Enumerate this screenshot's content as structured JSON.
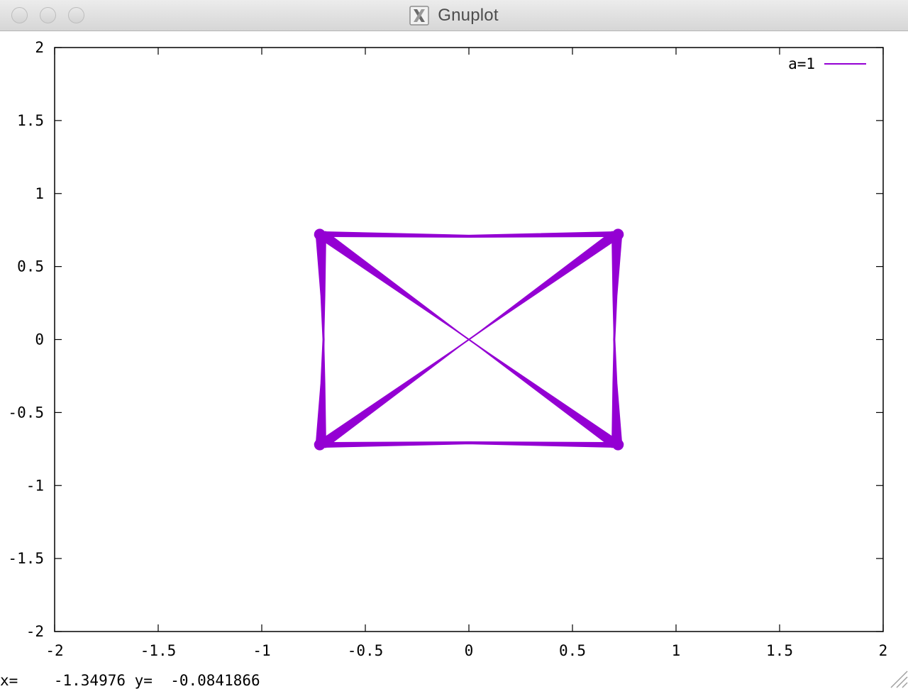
{
  "window": {
    "title": "Gnuplot"
  },
  "icons": {
    "app_icon": "x11-icon",
    "resize": "resize-grip-icon"
  },
  "chart_data": {
    "type": "line",
    "xlim": [
      -2,
      2
    ],
    "ylim": [
      -2,
      2
    ],
    "x_ticks": [
      "-2",
      "-1.5",
      "-1",
      "-0.5",
      "0",
      "0.5",
      "1",
      "1.5",
      "2"
    ],
    "y_ticks": [
      "-2",
      "-1.5",
      "-1",
      "-0.5",
      "0",
      "0.5",
      "1",
      "1.5",
      "2"
    ],
    "x_tick_values": [
      -2,
      -1.5,
      -1,
      -0.5,
      0,
      0.5,
      1,
      1.5,
      2
    ],
    "y_tick_values": [
      -2,
      -1.5,
      -1,
      -0.5,
      0,
      0.5,
      1,
      1.5,
      2
    ],
    "grid": false,
    "legend": "top-right",
    "series": [
      {
        "name": "a=1",
        "color": "#9400d3",
        "shape": "parametric bowtie-rectangle curve",
        "x": [
          0,
          0.72,
          0.7,
          0.72,
          0,
          -0.72,
          -0.7,
          -0.72,
          0
        ],
        "y": [
          0,
          0.72,
          0,
          -0.72,
          0,
          0.72,
          0,
          -0.72,
          0
        ],
        "envelope": {
          "x_range": [
            -0.74,
            0.74
          ],
          "y_range": [
            -0.74,
            0.74
          ]
        }
      }
    ]
  },
  "status": {
    "text": "x=    -1.34976 y=  -0.0841866"
  }
}
